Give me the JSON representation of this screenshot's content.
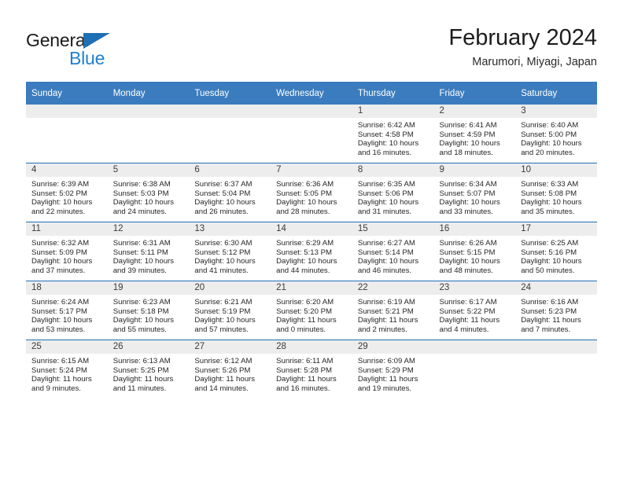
{
  "brand": {
    "line1": "General",
    "line2": "Blue",
    "triangle_color": "#1f6fb5",
    "blue_color": "#1f80d0"
  },
  "header": {
    "title": "February 2024",
    "subtitle": "Marumori, Miyagi, Japan"
  },
  "theme": {
    "header_bar": "#3a7cbe",
    "row_rule": "#1f6fb5",
    "daynum_band": "#ededed"
  },
  "weekday_headers": [
    "Sunday",
    "Monday",
    "Tuesday",
    "Wednesday",
    "Thursday",
    "Friday",
    "Saturday"
  ],
  "weeks": [
    [
      {
        "day": "",
        "empty": true,
        "sunrise": "",
        "sunset": "",
        "daylight1": "",
        "daylight2": ""
      },
      {
        "day": "",
        "empty": true,
        "sunrise": "",
        "sunset": "",
        "daylight1": "",
        "daylight2": ""
      },
      {
        "day": "",
        "empty": true,
        "sunrise": "",
        "sunset": "",
        "daylight1": "",
        "daylight2": ""
      },
      {
        "day": "",
        "empty": true,
        "sunrise": "",
        "sunset": "",
        "daylight1": "",
        "daylight2": ""
      },
      {
        "day": "1",
        "empty": false,
        "sunrise": "Sunrise: 6:42 AM",
        "sunset": "Sunset: 4:58 PM",
        "daylight1": "Daylight: 10 hours",
        "daylight2": "and 16 minutes."
      },
      {
        "day": "2",
        "empty": false,
        "sunrise": "Sunrise: 6:41 AM",
        "sunset": "Sunset: 4:59 PM",
        "daylight1": "Daylight: 10 hours",
        "daylight2": "and 18 minutes."
      },
      {
        "day": "3",
        "empty": false,
        "sunrise": "Sunrise: 6:40 AM",
        "sunset": "Sunset: 5:00 PM",
        "daylight1": "Daylight: 10 hours",
        "daylight2": "and 20 minutes."
      }
    ],
    [
      {
        "day": "4",
        "empty": false,
        "sunrise": "Sunrise: 6:39 AM",
        "sunset": "Sunset: 5:02 PM",
        "daylight1": "Daylight: 10 hours",
        "daylight2": "and 22 minutes."
      },
      {
        "day": "5",
        "empty": false,
        "sunrise": "Sunrise: 6:38 AM",
        "sunset": "Sunset: 5:03 PM",
        "daylight1": "Daylight: 10 hours",
        "daylight2": "and 24 minutes."
      },
      {
        "day": "6",
        "empty": false,
        "sunrise": "Sunrise: 6:37 AM",
        "sunset": "Sunset: 5:04 PM",
        "daylight1": "Daylight: 10 hours",
        "daylight2": "and 26 minutes."
      },
      {
        "day": "7",
        "empty": false,
        "sunrise": "Sunrise: 6:36 AM",
        "sunset": "Sunset: 5:05 PM",
        "daylight1": "Daylight: 10 hours",
        "daylight2": "and 28 minutes."
      },
      {
        "day": "8",
        "empty": false,
        "sunrise": "Sunrise: 6:35 AM",
        "sunset": "Sunset: 5:06 PM",
        "daylight1": "Daylight: 10 hours",
        "daylight2": "and 31 minutes."
      },
      {
        "day": "9",
        "empty": false,
        "sunrise": "Sunrise: 6:34 AM",
        "sunset": "Sunset: 5:07 PM",
        "daylight1": "Daylight: 10 hours",
        "daylight2": "and 33 minutes."
      },
      {
        "day": "10",
        "empty": false,
        "sunrise": "Sunrise: 6:33 AM",
        "sunset": "Sunset: 5:08 PM",
        "daylight1": "Daylight: 10 hours",
        "daylight2": "and 35 minutes."
      }
    ],
    [
      {
        "day": "11",
        "empty": false,
        "sunrise": "Sunrise: 6:32 AM",
        "sunset": "Sunset: 5:09 PM",
        "daylight1": "Daylight: 10 hours",
        "daylight2": "and 37 minutes."
      },
      {
        "day": "12",
        "empty": false,
        "sunrise": "Sunrise: 6:31 AM",
        "sunset": "Sunset: 5:11 PM",
        "daylight1": "Daylight: 10 hours",
        "daylight2": "and 39 minutes."
      },
      {
        "day": "13",
        "empty": false,
        "sunrise": "Sunrise: 6:30 AM",
        "sunset": "Sunset: 5:12 PM",
        "daylight1": "Daylight: 10 hours",
        "daylight2": "and 41 minutes."
      },
      {
        "day": "14",
        "empty": false,
        "sunrise": "Sunrise: 6:29 AM",
        "sunset": "Sunset: 5:13 PM",
        "daylight1": "Daylight: 10 hours",
        "daylight2": "and 44 minutes."
      },
      {
        "day": "15",
        "empty": false,
        "sunrise": "Sunrise: 6:27 AM",
        "sunset": "Sunset: 5:14 PM",
        "daylight1": "Daylight: 10 hours",
        "daylight2": "and 46 minutes."
      },
      {
        "day": "16",
        "empty": false,
        "sunrise": "Sunrise: 6:26 AM",
        "sunset": "Sunset: 5:15 PM",
        "daylight1": "Daylight: 10 hours",
        "daylight2": "and 48 minutes."
      },
      {
        "day": "17",
        "empty": false,
        "sunrise": "Sunrise: 6:25 AM",
        "sunset": "Sunset: 5:16 PM",
        "daylight1": "Daylight: 10 hours",
        "daylight2": "and 50 minutes."
      }
    ],
    [
      {
        "day": "18",
        "empty": false,
        "sunrise": "Sunrise: 6:24 AM",
        "sunset": "Sunset: 5:17 PM",
        "daylight1": "Daylight: 10 hours",
        "daylight2": "and 53 minutes."
      },
      {
        "day": "19",
        "empty": false,
        "sunrise": "Sunrise: 6:23 AM",
        "sunset": "Sunset: 5:18 PM",
        "daylight1": "Daylight: 10 hours",
        "daylight2": "and 55 minutes."
      },
      {
        "day": "20",
        "empty": false,
        "sunrise": "Sunrise: 6:21 AM",
        "sunset": "Sunset: 5:19 PM",
        "daylight1": "Daylight: 10 hours",
        "daylight2": "and 57 minutes."
      },
      {
        "day": "21",
        "empty": false,
        "sunrise": "Sunrise: 6:20 AM",
        "sunset": "Sunset: 5:20 PM",
        "daylight1": "Daylight: 11 hours",
        "daylight2": "and 0 minutes."
      },
      {
        "day": "22",
        "empty": false,
        "sunrise": "Sunrise: 6:19 AM",
        "sunset": "Sunset: 5:21 PM",
        "daylight1": "Daylight: 11 hours",
        "daylight2": "and 2 minutes."
      },
      {
        "day": "23",
        "empty": false,
        "sunrise": "Sunrise: 6:17 AM",
        "sunset": "Sunset: 5:22 PM",
        "daylight1": "Daylight: 11 hours",
        "daylight2": "and 4 minutes."
      },
      {
        "day": "24",
        "empty": false,
        "sunrise": "Sunrise: 6:16 AM",
        "sunset": "Sunset: 5:23 PM",
        "daylight1": "Daylight: 11 hours",
        "daylight2": "and 7 minutes."
      }
    ],
    [
      {
        "day": "25",
        "empty": false,
        "sunrise": "Sunrise: 6:15 AM",
        "sunset": "Sunset: 5:24 PM",
        "daylight1": "Daylight: 11 hours",
        "daylight2": "and 9 minutes."
      },
      {
        "day": "26",
        "empty": false,
        "sunrise": "Sunrise: 6:13 AM",
        "sunset": "Sunset: 5:25 PM",
        "daylight1": "Daylight: 11 hours",
        "daylight2": "and 11 minutes."
      },
      {
        "day": "27",
        "empty": false,
        "sunrise": "Sunrise: 6:12 AM",
        "sunset": "Sunset: 5:26 PM",
        "daylight1": "Daylight: 11 hours",
        "daylight2": "and 14 minutes."
      },
      {
        "day": "28",
        "empty": false,
        "sunrise": "Sunrise: 6:11 AM",
        "sunset": "Sunset: 5:28 PM",
        "daylight1": "Daylight: 11 hours",
        "daylight2": "and 16 minutes."
      },
      {
        "day": "29",
        "empty": false,
        "sunrise": "Sunrise: 6:09 AM",
        "sunset": "Sunset: 5:29 PM",
        "daylight1": "Daylight: 11 hours",
        "daylight2": "and 19 minutes."
      },
      {
        "day": "",
        "empty": true,
        "sunrise": "",
        "sunset": "",
        "daylight1": "",
        "daylight2": ""
      },
      {
        "day": "",
        "empty": true,
        "sunrise": "",
        "sunset": "",
        "daylight1": "",
        "daylight2": ""
      }
    ]
  ]
}
